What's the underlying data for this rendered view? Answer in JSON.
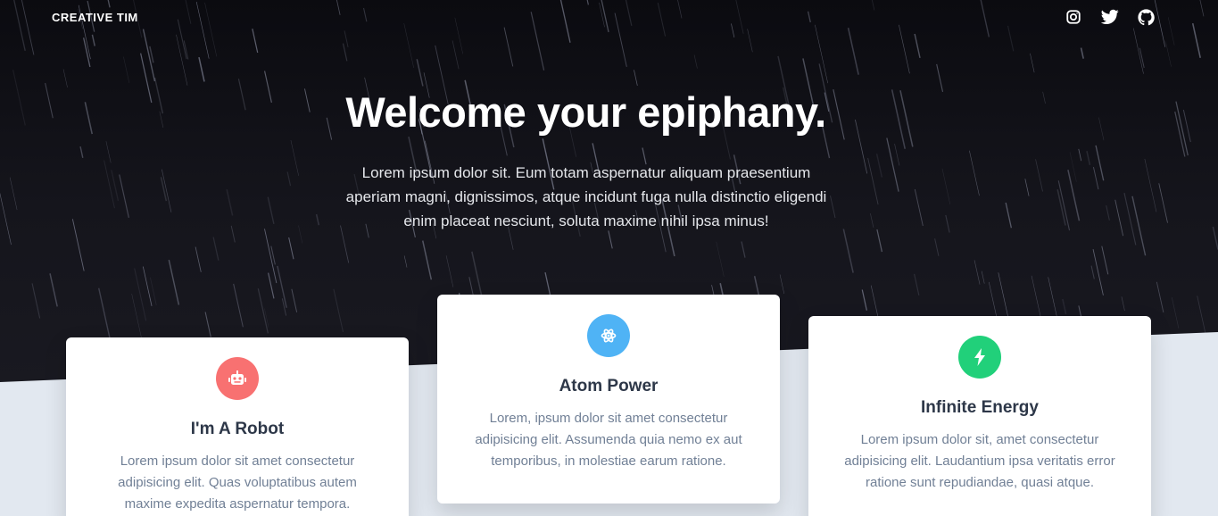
{
  "nav": {
    "brand": "CREATIVE TIM",
    "icons": [
      "instagram-icon",
      "twitter-icon",
      "github-icon"
    ]
  },
  "hero": {
    "title": "Welcome your epiphany.",
    "subtitle": "Lorem ipsum dolor sit. Eum totam aspernatur aliquam praesentium aperiam magni, dignissimos, atque incidunt fuga nulla distinctio eligendi enim placeat nesciunt, soluta maxime nihil ipsa minus!"
  },
  "cards": [
    {
      "title": "I'm A Robot",
      "text": "Lorem ipsum dolor sit amet consectetur adipisicing elit. Quas voluptatibus autem maxime expedita aspernatur tempora.",
      "icon": "robot-icon",
      "color": "#f87171"
    },
    {
      "title": "Atom Power",
      "text": "Lorem, ipsum dolor sit amet consectetur adipisicing elit. Assumenda quia nemo ex aut temporibus, in molestiae earum ratione.",
      "icon": "atom-icon",
      "color": "#4fb3f5"
    },
    {
      "title": "Infinite Energy",
      "text": "Lorem ipsum dolor sit, amet consectetur adipisicing elit. Laudantium ipsa veritatis error ratione sunt repudiandae, quasi atque.",
      "icon": "lightning-icon",
      "color": "#21d07a"
    }
  ]
}
